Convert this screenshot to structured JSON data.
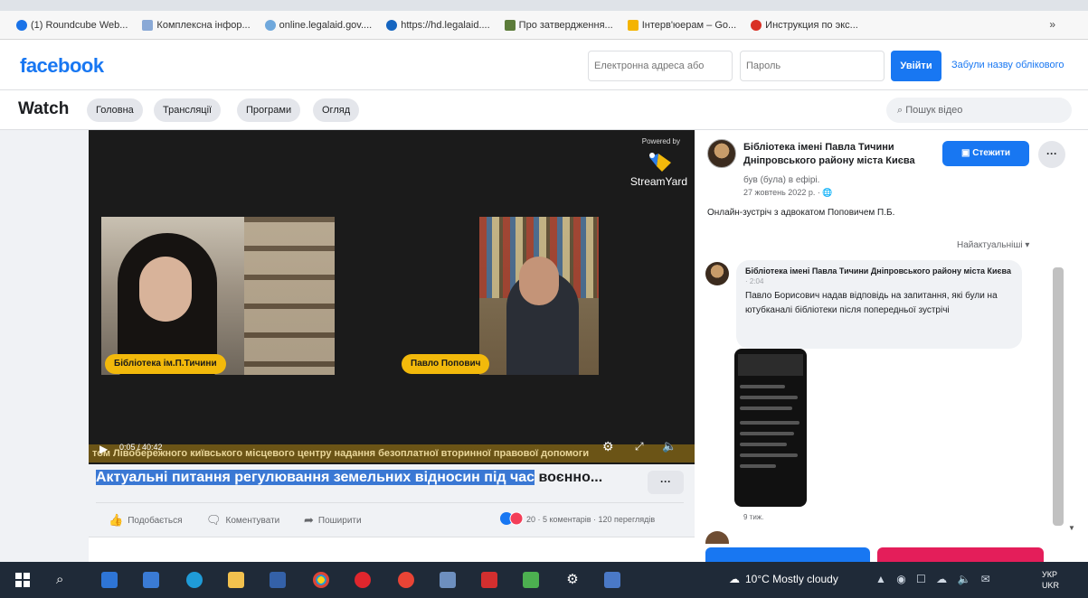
{
  "bookmarks": [
    {
      "label": "(1) Roundcube Web...",
      "color": "#1a73e8"
    },
    {
      "label": "Комплексна інфор...",
      "color": "#8aa9d6"
    },
    {
      "label": "online.legalaid.gov....",
      "color": "#6fa8dc"
    },
    {
      "label": "https://hd.legalaid....",
      "color": "#1565c0"
    },
    {
      "label": "Про затвердження...",
      "color": "#5c7c3a"
    },
    {
      "label": "Інтерв'юерам – Go...",
      "color": "#f4b400"
    },
    {
      "label": "Инструкция по экс...",
      "color": "#d93025"
    }
  ],
  "bookmarks_more": "»",
  "header": {
    "logo": "facebook",
    "email_placeholder": "Електронна адреса або",
    "password_placeholder": "Пароль",
    "login_label": "Увійти",
    "forgot_label": "Забули назву облікового"
  },
  "watch": {
    "title": "Watch",
    "tabs": [
      "Головна",
      "Трансляції",
      "Програми",
      "Огляд"
    ],
    "search_placeholder": "Пошук відео"
  },
  "video": {
    "powered_by": "Powered by",
    "brand": "StreamYard",
    "left_name": "Бібліотека ім.П.Тичини",
    "right_name": "Павло Попович",
    "ticker": "том Лівобережного київського місцевого центру надання безоплатної вторинної правової допомоги",
    "timecode": "0:05 / 40:42"
  },
  "title": {
    "highlighted": "Актуальні питання регулювання земельних відносин під час",
    "rest": " воєнно...",
    "more": "···"
  },
  "actions": {
    "like": "Подобається",
    "comment": "Коментувати",
    "share": "Поширити",
    "stats": "20 · 5 коментарів · 120 переглядів"
  },
  "panel": {
    "page_name": "Бібліотека імені Павла Тичини Дніпровського району міста Києва",
    "live_state": "був (була) в ефірі.",
    "post_date": "27 жовтень 2022 р. · ",
    "follow_label": "Стежити",
    "more": "···",
    "description": "Онлайн-зустріч з адвокатом Поповичем П.Б.",
    "sort_label": "Найактуальніші ▾",
    "comment": {
      "author": "Бібліотека імені Павла Тичини Дніпровського району міста Києва",
      "sub": "· 2:04",
      "text": "Павло Борисович надав відповідь на запитання, які були на ютубканалі бібліотеки після попередньої зустрічі",
      "time": "9 тиж."
    }
  },
  "taskbar": {
    "weather": "10°C  Mostly cloudy",
    "lang": "УКР",
    "lang2": "UKR",
    "tray": "▲ ◉ ☐ ☁ 🔈 ✉"
  },
  "colors": {
    "brand": "#1877f2",
    "name_tag": "#f2b90b",
    "selection": "#3a78d4"
  }
}
